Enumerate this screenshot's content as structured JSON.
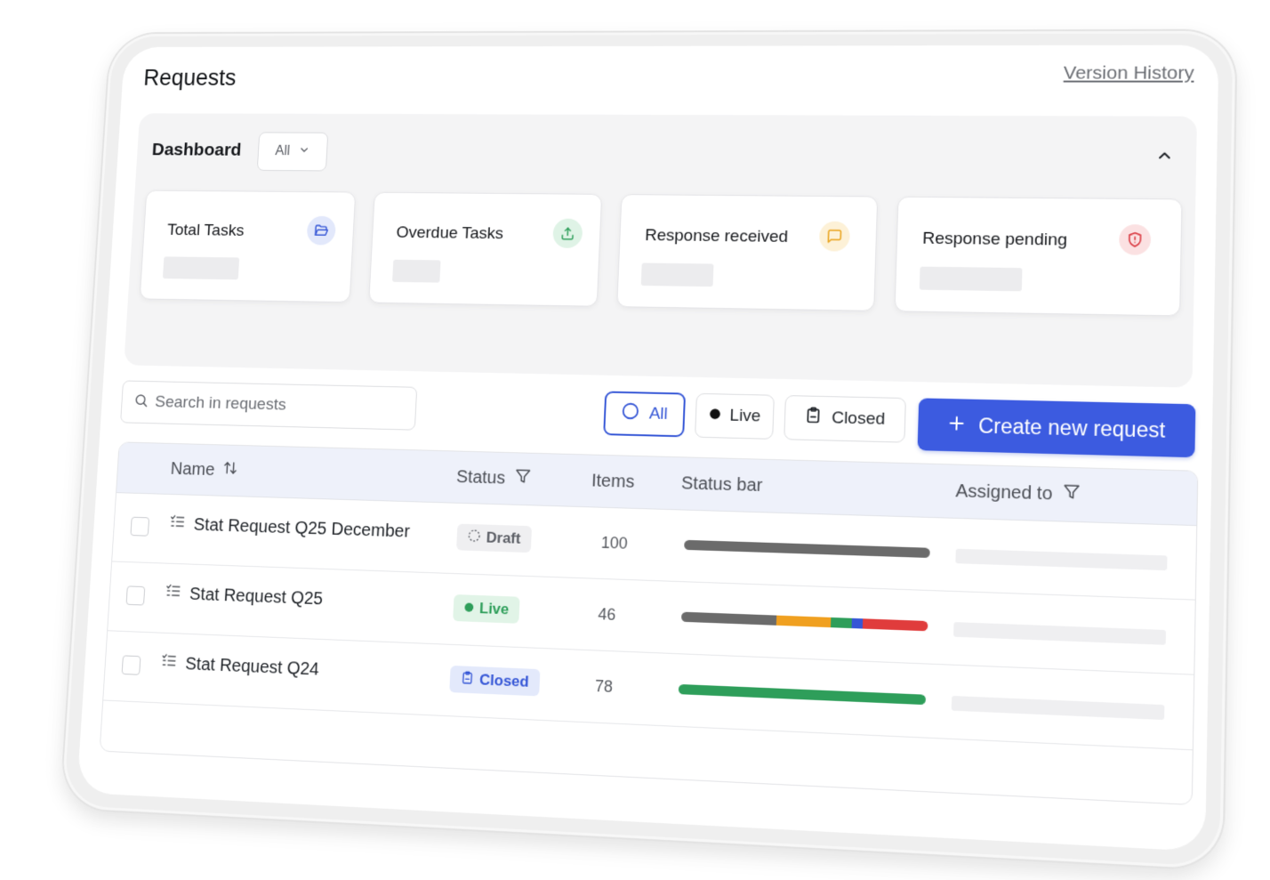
{
  "header": {
    "title": "Requests",
    "version_link": "Version History"
  },
  "dashboard": {
    "title": "Dashboard",
    "filter_value": "All",
    "collapse_icon": "chevron-up-icon",
    "cards": [
      {
        "label": "Total Tasks",
        "icon": "folder-open-icon",
        "icon_color": "#3556d6",
        "icon_bg": "#e2e8fb"
      },
      {
        "label": "Overdue Tasks",
        "icon": "upload-icon",
        "icon_color": "#2e9e5a",
        "icon_bg": "#dff3e6"
      },
      {
        "label": "Response received",
        "icon": "message-square-icon",
        "icon_color": "#e9a21a",
        "icon_bg": "#fdf1d7"
      },
      {
        "label": "Response pending",
        "icon": "shield-alert-icon",
        "icon_color": "#d9363e",
        "icon_bg": "#fbe1e2"
      }
    ]
  },
  "search": {
    "placeholder": "Search in requests"
  },
  "filters": {
    "all": "All",
    "live": "Live",
    "closed": "Closed"
  },
  "create_button": "Create new request",
  "table": {
    "columns": {
      "name": "Name",
      "status": "Status",
      "items": "Items",
      "status_bar": "Status bar",
      "assigned_to": "Assigned to"
    },
    "rows": [
      {
        "name": "Stat Request Q25 December",
        "status": "Draft",
        "items": "100",
        "segments": [
          {
            "color": "#6b6b6b",
            "fraction": 1.0
          }
        ]
      },
      {
        "name": "Stat Request Q25",
        "status": "Live",
        "items": "46",
        "segments": [
          {
            "color": "#6b6b6b",
            "fraction": 0.39
          },
          {
            "color": "#f0a020",
            "fraction": 0.22
          },
          {
            "color": "#2e9e5a",
            "fraction": 0.085
          },
          {
            "color": "#3556d6",
            "fraction": 0.045
          },
          {
            "color": "#e03c3c",
            "fraction": 0.26
          }
        ]
      },
      {
        "name": "Stat Request Q24",
        "status": "Closed",
        "items": "78",
        "segments": [
          {
            "color": "#2e9e5a",
            "fraction": 1.0
          }
        ]
      }
    ]
  },
  "status_styles": {
    "Draft": {
      "bg": "#efeff1",
      "color": "#5b5e65"
    },
    "Live": {
      "bg": "#e1f4e7",
      "color": "#2e9e5a"
    },
    "Closed": {
      "bg": "#e3e9fb",
      "color": "#3556d6"
    }
  }
}
